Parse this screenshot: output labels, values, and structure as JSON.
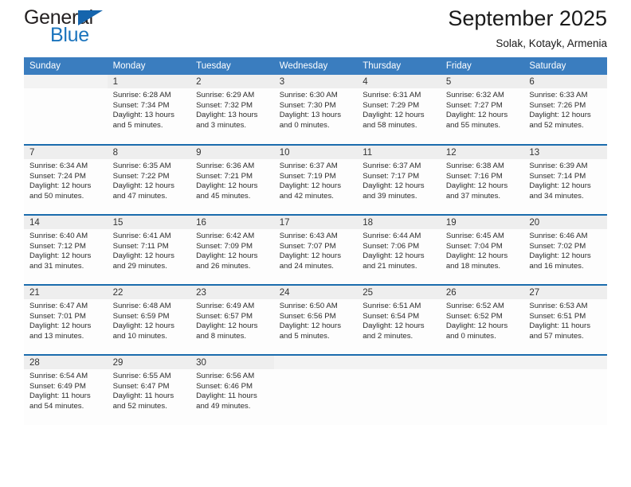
{
  "brand": {
    "word_one": "General",
    "word_two": "Blue",
    "triangle_icon": "triangle-icon",
    "accent_color": "#1b74bd",
    "dark_color": "#231f20"
  },
  "header": {
    "title": "September 2025",
    "subtitle": "Solak, Kotayk, Armenia",
    "header_bg": "#3a7dbf",
    "row_divider": "#1b6cad",
    "daynum_bg": "#eeeeee"
  },
  "weekday_headers": [
    "Sunday",
    "Monday",
    "Tuesday",
    "Wednesday",
    "Thursday",
    "Friday",
    "Saturday"
  ],
  "labels": {
    "sunrise": "Sunrise:",
    "sunset": "Sunset:",
    "daylight": "Daylight:"
  },
  "weeks": [
    [
      {
        "day": "",
        "empty": true
      },
      {
        "day": "1",
        "sunrise": "Sunrise: 6:28 AM",
        "sunset": "Sunset: 7:34 PM",
        "daylight_1": "Daylight: 13 hours",
        "daylight_2": "and 5 minutes."
      },
      {
        "day": "2",
        "sunrise": "Sunrise: 6:29 AM",
        "sunset": "Sunset: 7:32 PM",
        "daylight_1": "Daylight: 13 hours",
        "daylight_2": "and 3 minutes."
      },
      {
        "day": "3",
        "sunrise": "Sunrise: 6:30 AM",
        "sunset": "Sunset: 7:30 PM",
        "daylight_1": "Daylight: 13 hours",
        "daylight_2": "and 0 minutes."
      },
      {
        "day": "4",
        "sunrise": "Sunrise: 6:31 AM",
        "sunset": "Sunset: 7:29 PM",
        "daylight_1": "Daylight: 12 hours",
        "daylight_2": "and 58 minutes."
      },
      {
        "day": "5",
        "sunrise": "Sunrise: 6:32 AM",
        "sunset": "Sunset: 7:27 PM",
        "daylight_1": "Daylight: 12 hours",
        "daylight_2": "and 55 minutes."
      },
      {
        "day": "6",
        "sunrise": "Sunrise: 6:33 AM",
        "sunset": "Sunset: 7:26 PM",
        "daylight_1": "Daylight: 12 hours",
        "daylight_2": "and 52 minutes."
      }
    ],
    [
      {
        "day": "7",
        "sunrise": "Sunrise: 6:34 AM",
        "sunset": "Sunset: 7:24 PM",
        "daylight_1": "Daylight: 12 hours",
        "daylight_2": "and 50 minutes."
      },
      {
        "day": "8",
        "sunrise": "Sunrise: 6:35 AM",
        "sunset": "Sunset: 7:22 PM",
        "daylight_1": "Daylight: 12 hours",
        "daylight_2": "and 47 minutes."
      },
      {
        "day": "9",
        "sunrise": "Sunrise: 6:36 AM",
        "sunset": "Sunset: 7:21 PM",
        "daylight_1": "Daylight: 12 hours",
        "daylight_2": "and 45 minutes."
      },
      {
        "day": "10",
        "sunrise": "Sunrise: 6:37 AM",
        "sunset": "Sunset: 7:19 PM",
        "daylight_1": "Daylight: 12 hours",
        "daylight_2": "and 42 minutes."
      },
      {
        "day": "11",
        "sunrise": "Sunrise: 6:37 AM",
        "sunset": "Sunset: 7:17 PM",
        "daylight_1": "Daylight: 12 hours",
        "daylight_2": "and 39 minutes."
      },
      {
        "day": "12",
        "sunrise": "Sunrise: 6:38 AM",
        "sunset": "Sunset: 7:16 PM",
        "daylight_1": "Daylight: 12 hours",
        "daylight_2": "and 37 minutes."
      },
      {
        "day": "13",
        "sunrise": "Sunrise: 6:39 AM",
        "sunset": "Sunset: 7:14 PM",
        "daylight_1": "Daylight: 12 hours",
        "daylight_2": "and 34 minutes."
      }
    ],
    [
      {
        "day": "14",
        "sunrise": "Sunrise: 6:40 AM",
        "sunset": "Sunset: 7:12 PM",
        "daylight_1": "Daylight: 12 hours",
        "daylight_2": "and 31 minutes."
      },
      {
        "day": "15",
        "sunrise": "Sunrise: 6:41 AM",
        "sunset": "Sunset: 7:11 PM",
        "daylight_1": "Daylight: 12 hours",
        "daylight_2": "and 29 minutes."
      },
      {
        "day": "16",
        "sunrise": "Sunrise: 6:42 AM",
        "sunset": "Sunset: 7:09 PM",
        "daylight_1": "Daylight: 12 hours",
        "daylight_2": "and 26 minutes."
      },
      {
        "day": "17",
        "sunrise": "Sunrise: 6:43 AM",
        "sunset": "Sunset: 7:07 PM",
        "daylight_1": "Daylight: 12 hours",
        "daylight_2": "and 24 minutes."
      },
      {
        "day": "18",
        "sunrise": "Sunrise: 6:44 AM",
        "sunset": "Sunset: 7:06 PM",
        "daylight_1": "Daylight: 12 hours",
        "daylight_2": "and 21 minutes."
      },
      {
        "day": "19",
        "sunrise": "Sunrise: 6:45 AM",
        "sunset": "Sunset: 7:04 PM",
        "daylight_1": "Daylight: 12 hours",
        "daylight_2": "and 18 minutes."
      },
      {
        "day": "20",
        "sunrise": "Sunrise: 6:46 AM",
        "sunset": "Sunset: 7:02 PM",
        "daylight_1": "Daylight: 12 hours",
        "daylight_2": "and 16 minutes."
      }
    ],
    [
      {
        "day": "21",
        "sunrise": "Sunrise: 6:47 AM",
        "sunset": "Sunset: 7:01 PM",
        "daylight_1": "Daylight: 12 hours",
        "daylight_2": "and 13 minutes."
      },
      {
        "day": "22",
        "sunrise": "Sunrise: 6:48 AM",
        "sunset": "Sunset: 6:59 PM",
        "daylight_1": "Daylight: 12 hours",
        "daylight_2": "and 10 minutes."
      },
      {
        "day": "23",
        "sunrise": "Sunrise: 6:49 AM",
        "sunset": "Sunset: 6:57 PM",
        "daylight_1": "Daylight: 12 hours",
        "daylight_2": "and 8 minutes."
      },
      {
        "day": "24",
        "sunrise": "Sunrise: 6:50 AM",
        "sunset": "Sunset: 6:56 PM",
        "daylight_1": "Daylight: 12 hours",
        "daylight_2": "and 5 minutes."
      },
      {
        "day": "25",
        "sunrise": "Sunrise: 6:51 AM",
        "sunset": "Sunset: 6:54 PM",
        "daylight_1": "Daylight: 12 hours",
        "daylight_2": "and 2 minutes."
      },
      {
        "day": "26",
        "sunrise": "Sunrise: 6:52 AM",
        "sunset": "Sunset: 6:52 PM",
        "daylight_1": "Daylight: 12 hours",
        "daylight_2": "and 0 minutes."
      },
      {
        "day": "27",
        "sunrise": "Sunrise: 6:53 AM",
        "sunset": "Sunset: 6:51 PM",
        "daylight_1": "Daylight: 11 hours",
        "daylight_2": "and 57 minutes."
      }
    ],
    [
      {
        "day": "28",
        "sunrise": "Sunrise: 6:54 AM",
        "sunset": "Sunset: 6:49 PM",
        "daylight_1": "Daylight: 11 hours",
        "daylight_2": "and 54 minutes."
      },
      {
        "day": "29",
        "sunrise": "Sunrise: 6:55 AM",
        "sunset": "Sunset: 6:47 PM",
        "daylight_1": "Daylight: 11 hours",
        "daylight_2": "and 52 minutes."
      },
      {
        "day": "30",
        "sunrise": "Sunrise: 6:56 AM",
        "sunset": "Sunset: 6:46 PM",
        "daylight_1": "Daylight: 11 hours",
        "daylight_2": "and 49 minutes."
      },
      {
        "day": "",
        "empty": true
      },
      {
        "day": "",
        "empty": true
      },
      {
        "day": "",
        "empty": true
      },
      {
        "day": "",
        "empty": true
      }
    ]
  ]
}
